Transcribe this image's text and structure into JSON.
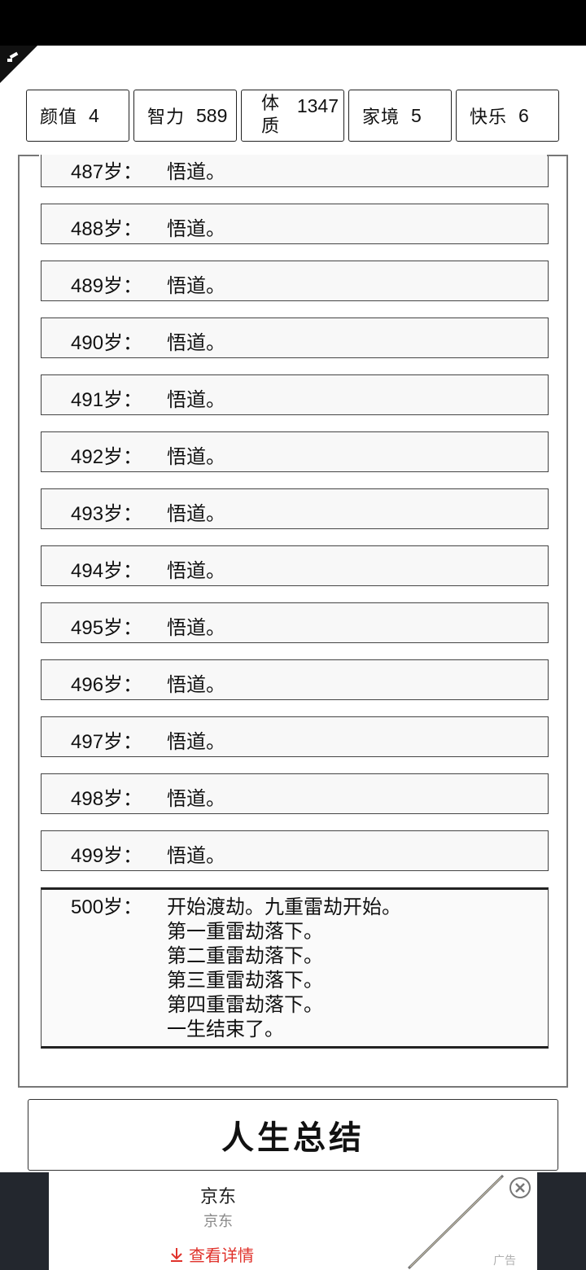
{
  "stats": [
    {
      "label": "颜值",
      "value": "4"
    },
    {
      "label": "智力",
      "value": "589"
    },
    {
      "label": "体质",
      "value": "1347"
    },
    {
      "label": "家境",
      "value": "5"
    },
    {
      "label": "快乐",
      "value": "6"
    }
  ],
  "entries": [
    {
      "age": "487",
      "unit": "岁：",
      "text": "悟道。"
    },
    {
      "age": "488",
      "unit": "岁：",
      "text": "悟道。"
    },
    {
      "age": "489",
      "unit": "岁：",
      "text": "悟道。"
    },
    {
      "age": "490",
      "unit": "岁：",
      "text": "悟道。"
    },
    {
      "age": "491",
      "unit": "岁：",
      "text": "悟道。"
    },
    {
      "age": "492",
      "unit": "岁：",
      "text": "悟道。"
    },
    {
      "age": "493",
      "unit": "岁：",
      "text": "悟道。"
    },
    {
      "age": "494",
      "unit": "岁：",
      "text": "悟道。"
    },
    {
      "age": "495",
      "unit": "岁：",
      "text": "悟道。"
    },
    {
      "age": "496",
      "unit": "岁：",
      "text": "悟道。"
    },
    {
      "age": "497",
      "unit": "岁：",
      "text": "悟道。"
    },
    {
      "age": "498",
      "unit": "岁：",
      "text": "悟道。"
    },
    {
      "age": "499",
      "unit": "岁：",
      "text": "悟道。"
    }
  ],
  "final_entry": {
    "age": "500",
    "unit": "岁：",
    "lines": [
      "开始渡劫。九重雷劫开始。",
      "第一重雷劫落下。",
      "第二重雷劫落下。",
      "第三重雷劫落下。",
      "第四重雷劫落下。",
      "一生结束了。"
    ]
  },
  "summary_button": "人生总结",
  "ad": {
    "title": "京东",
    "subtitle": "京东",
    "detail_label": "查看详情",
    "tag": "广告",
    "accent_color": "#e0322b"
  }
}
